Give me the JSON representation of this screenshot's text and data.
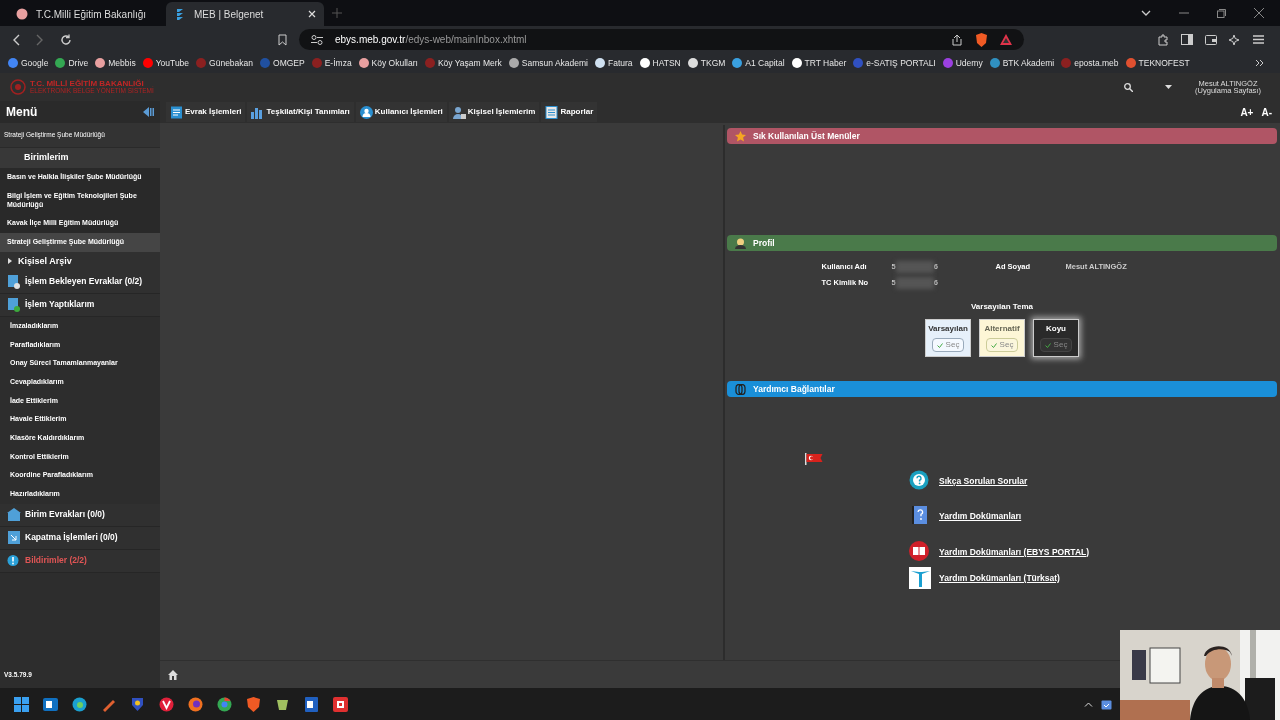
{
  "browser": {
    "tabs": [
      {
        "title": "T.C.Milli Eğitim Bakanlığı",
        "selected": false
      },
      {
        "title": "MEB | Belgenet",
        "selected": true
      }
    ],
    "url": {
      "host": "ebys.meb.gov.tr",
      "path": "/edys-web/mainInbox.xhtml"
    },
    "bookmarks": [
      "Google",
      "Drive",
      "Mebbis",
      "YouTube",
      "Günebakan",
      "OMGEP",
      "E-İmza",
      "Köy Okulları",
      "Köy Yaşam Merk",
      "Samsun Akademi",
      "Fatura",
      "HATSN",
      "TKGM",
      "A1 Capital",
      "TRT Haber",
      "e-SATIŞ PORTALI",
      "Udemy",
      "BTK Akademi",
      "eposta.meb",
      "TEKNOFEST"
    ]
  },
  "app": {
    "logo": [
      "T.C. MİLLİ EĞİTİM BAKANLIĞI",
      "ELEKTRONİK BELGE YÖNETİM SİSTEMİ"
    ],
    "user": {
      "name": "Mesut ALTINGÖZ",
      "subtitle": "(Uygulama Sayfası)"
    },
    "font_buttons": [
      "A+",
      "A-"
    ],
    "menu_title": "Menü",
    "top_menu": [
      {
        "label": "Evrak İşlemleri",
        "kind": "doc"
      },
      {
        "label": "Teşkilat/Kişi Tanımları",
        "kind": "chart"
      },
      {
        "label": "Kullanıcı İşlemleri",
        "kind": "user"
      },
      {
        "label": "Kişisel İşlemlerim",
        "kind": "person"
      },
      {
        "label": "Raporlar",
        "kind": "report"
      }
    ]
  },
  "sidebar": {
    "current_unit": "Strateji Geliştirme Şube Müdürlüğü",
    "units_title": "Birimlerim",
    "units": [
      {
        "label": "Basın ve Halkla İlişkiler Şube Müdürlüğü",
        "selected": false
      },
      {
        "label": "Bilgi İşlem ve Eğitim Teknolojileri Şube Müdürlüğü",
        "selected": false
      },
      {
        "label": "Kavak İlçe Milli Eğitim Müdürlüğü",
        "selected": false
      },
      {
        "label": "Strateji Geliştirme Şube Müdürlüğü",
        "selected": true
      }
    ],
    "archive": {
      "label": "Kişisel Arşiv",
      "expanded": false
    },
    "sections": [
      {
        "label": "İşlem Bekleyen Evraklar (0/2)",
        "kind": "pending"
      },
      {
        "label": "İşlem Yaptıklarım",
        "kind": "done",
        "children": [
          "İmzaladıklarım",
          "Parafladıklarım",
          "Onay Süreci Tamamlanmayanlar",
          "Cevapladıklarım",
          "İade Ettiklerim",
          "Havale Ettiklerim",
          "Klasöre Kaldırdıklarım",
          "Kontrol Ettiklerim",
          "Koordine Parafladıklarım",
          "Hazırladıklarım"
        ]
      },
      {
        "label": "Birim Evrakları (0/0)",
        "kind": "unit"
      },
      {
        "label": "Kapatma İşlemleri (0/0)",
        "kind": "closing"
      },
      {
        "label": "Bildirimler (2/2)",
        "kind": "alert"
      }
    ],
    "version": "V3.5.79.9"
  },
  "panels": {
    "favorites": {
      "title": "Sık Kullanılan Üst Menüler"
    },
    "profile": {
      "title": "Profil",
      "fields": [
        {
          "label": "Kullanıcı Adı",
          "value_start": "5",
          "value_end": "6"
        },
        {
          "label": "TC Kimlik No",
          "value_start": "5",
          "value_end": "6"
        }
      ],
      "name_label": "Ad Soyad",
      "name_value": "Mesut ALTINGÖZ",
      "theme_title": "Varsayılan Tema",
      "themes": [
        {
          "label": "Varsayılan",
          "button": "Seç",
          "kind": "light",
          "selected": false
        },
        {
          "label": "Alternatif",
          "button": "Seç",
          "kind": "cream",
          "selected": false
        },
        {
          "label": "Koyu",
          "button": "Seç",
          "kind": "dark",
          "selected": true
        }
      ]
    },
    "help": {
      "title": "Yardımcı Bağlantılar",
      "links": [
        {
          "label": "Sıkça Sorulan Sorular",
          "kind": "faq"
        },
        {
          "label": "Yardım Dokümanları",
          "kind": "book"
        },
        {
          "label": "Yardım Dokümanları (EBYS PORTAL)",
          "kind": "portal"
        },
        {
          "label": "Yardım Dokümanları (Türksat)",
          "kind": "turksat"
        }
      ]
    }
  }
}
